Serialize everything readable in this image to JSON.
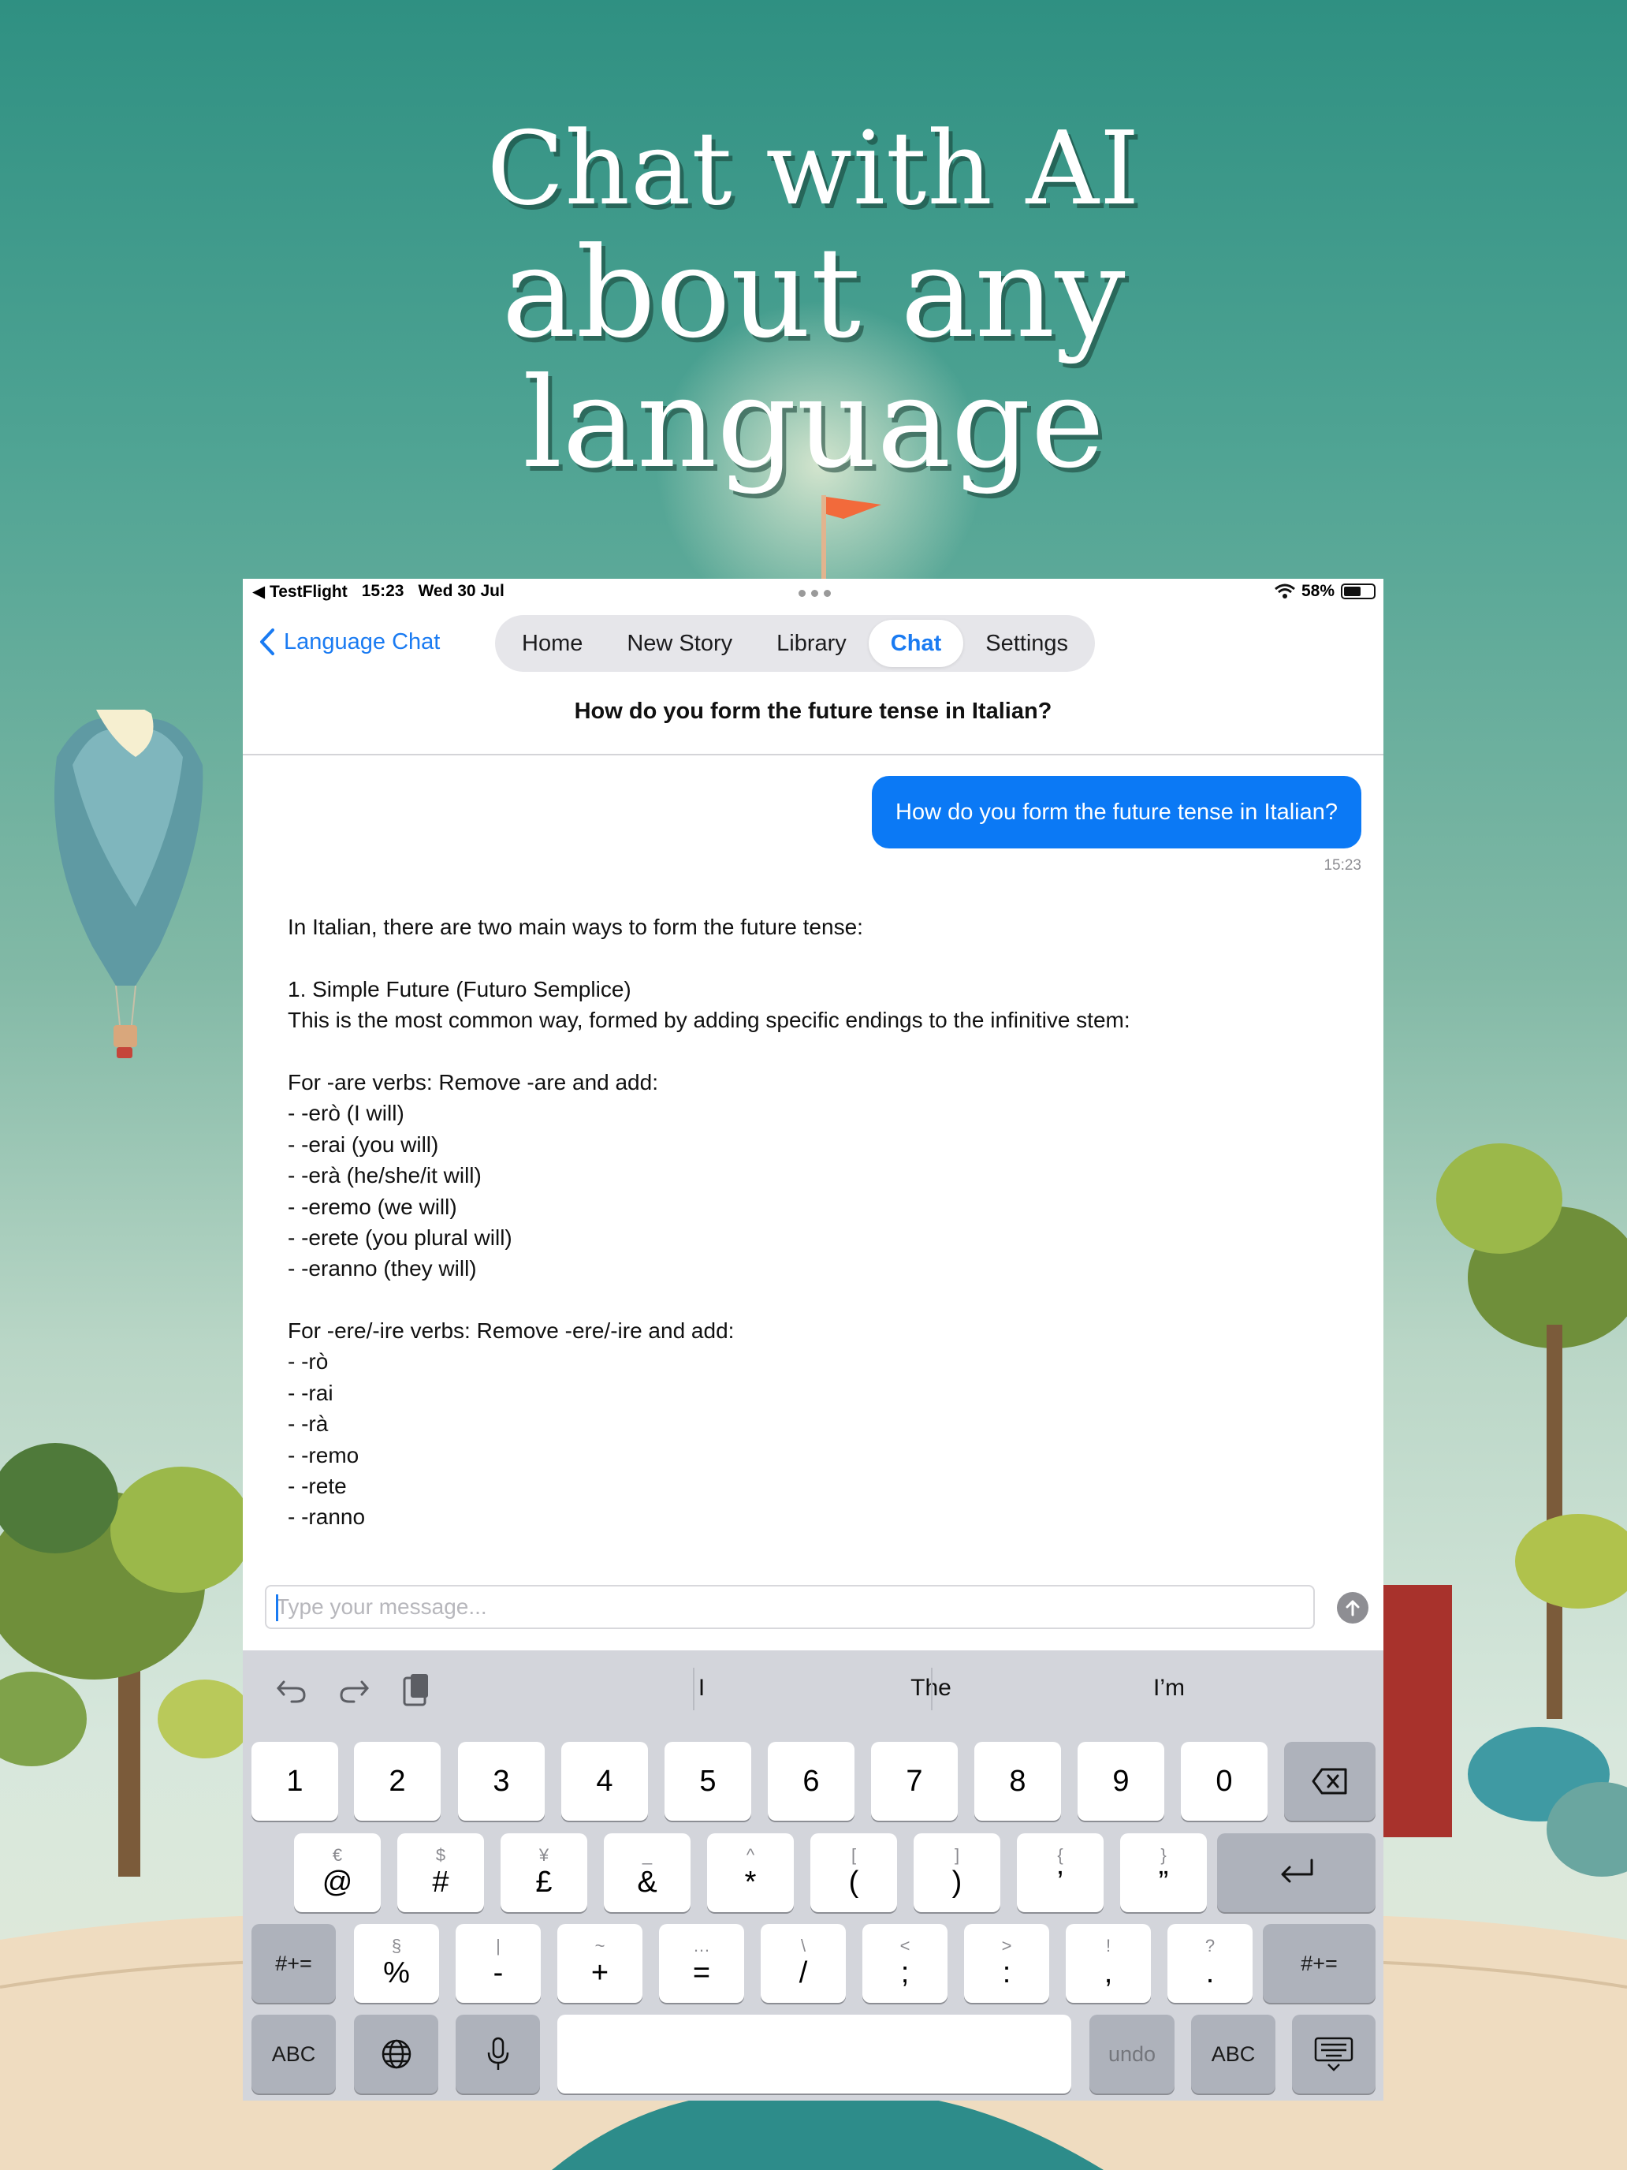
{
  "headline": {
    "line1": "Chat with AI",
    "line2": "about any",
    "line3": "language"
  },
  "status_bar": {
    "app": "◀ TestFlight",
    "time": "15:23",
    "date": "Wed 30 Jul",
    "battery": "58%",
    "battery_level": 0.58
  },
  "nav": {
    "back_label": "Language Chat",
    "tabs": [
      {
        "label": "Home",
        "active": false
      },
      {
        "label": "New Story",
        "active": false
      },
      {
        "label": "Library",
        "active": false
      },
      {
        "label": "Chat",
        "active": true
      },
      {
        "label": "Settings",
        "active": false
      }
    ]
  },
  "chat": {
    "title": "How do you form the future tense in Italian?",
    "user_message": "How do you form the future tense in Italian?",
    "user_time": "15:23",
    "answer_lines": [
      "In Italian, there are two main ways to form the future tense:",
      "",
      "1. Simple Future (Futuro Semplice)",
      "This is the most common way, formed by adding specific endings to the infinitive stem:",
      "",
      "For -are verbs: Remove -are and add:",
      "- -erò (I will)",
      "- -erai (you will)",
      "- -erà (he/she/it will)",
      "- -eremo (we will)",
      "- -erete (you plural will)",
      "- -eranno (they will)",
      "",
      "For -ere/-ire verbs: Remove -ere/-ire and add:",
      "- -rò",
      "- -rai",
      "- -rà",
      "- -remo",
      "- -rete",
      "- -ranno"
    ]
  },
  "input": {
    "placeholder": "Type your message...",
    "value": ""
  },
  "keyboard": {
    "suggestions": [
      "I",
      "The",
      "I’m"
    ],
    "row1": [
      "1",
      "2",
      "3",
      "4",
      "5",
      "6",
      "7",
      "8",
      "9",
      "0"
    ],
    "row2": [
      {
        "alt": "€",
        "main": "@"
      },
      {
        "alt": "$",
        "main": "#"
      },
      {
        "alt": "¥",
        "main": "£"
      },
      {
        "alt": "_",
        "main": "&"
      },
      {
        "alt": "^",
        "main": "*"
      },
      {
        "alt": "[",
        "main": "("
      },
      {
        "alt": "]",
        "main": ")"
      },
      {
        "alt": "{",
        "main": "’"
      },
      {
        "alt": "}",
        "main": "”"
      }
    ],
    "row3": [
      {
        "alt": "§",
        "main": "%"
      },
      {
        "alt": "|",
        "main": "-"
      },
      {
        "alt": "~",
        "main": "+"
      },
      {
        "alt": "…",
        "main": "="
      },
      {
        "alt": "\\",
        "main": "/"
      },
      {
        "alt": "<",
        "main": ";"
      },
      {
        "alt": ">",
        "main": ":"
      },
      {
        "alt": "!",
        "main": ","
      },
      {
        "alt": "?",
        "main": "."
      }
    ],
    "shift_label": "#+=",
    "abc_label": "ABC",
    "undo_label": "undo"
  },
  "icons": {
    "back": "chevron-left-icon",
    "wifi": "wifi-icon",
    "battery": "battery-icon",
    "send": "arrow-up-icon",
    "undo": "undo-icon",
    "redo": "redo-icon",
    "paste": "clipboard-icon",
    "delete": "delete-left-icon",
    "return": "return-icon",
    "globe": "globe-icon",
    "mic": "microphone-icon",
    "hide_keyboard": "keyboard-hide-icon"
  },
  "colors": {
    "accent": "#1a7bf2",
    "bubble": "#0b79f5",
    "keyboard_bg": "#d3d5db",
    "background_top": "#2f9082"
  }
}
